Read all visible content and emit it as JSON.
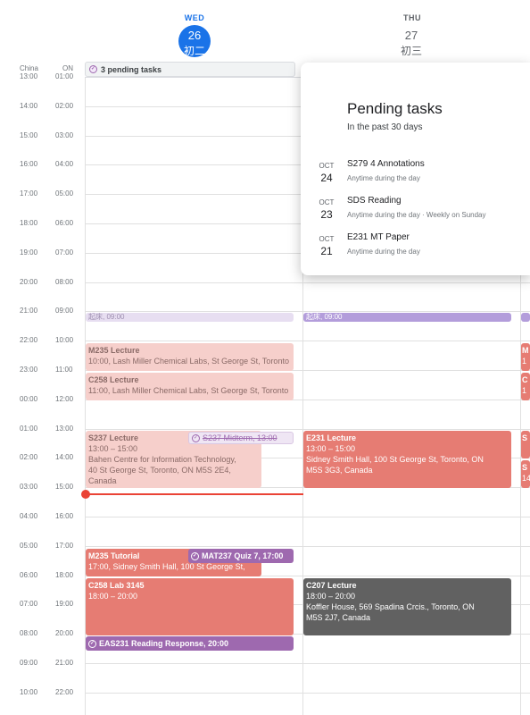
{
  "days": [
    {
      "dow": "WED",
      "num": "26",
      "lunar": "初二"
    },
    {
      "dow": "THU",
      "num": "27",
      "lunar": "初三"
    }
  ],
  "timezones": {
    "primary": "China",
    "secondary": "ON"
  },
  "times": [
    [
      "13:00",
      "01:00"
    ],
    [
      "14:00",
      "02:00"
    ],
    [
      "15:00",
      "03:00"
    ],
    [
      "16:00",
      "04:00"
    ],
    [
      "17:00",
      "05:00"
    ],
    [
      "18:00",
      "06:00"
    ],
    [
      "19:00",
      "07:00"
    ],
    [
      "20:00",
      "08:00"
    ],
    [
      "21:00",
      "09:00"
    ],
    [
      "22:00",
      "10:00"
    ],
    [
      "23:00",
      "11:00"
    ],
    [
      "00:00",
      "12:00"
    ],
    [
      "01:00",
      "13:00"
    ],
    [
      "02:00",
      "14:00"
    ],
    [
      "03:00",
      "15:00"
    ],
    [
      "04:00",
      "16:00"
    ],
    [
      "05:00",
      "17:00"
    ],
    [
      "06:00",
      "18:00"
    ],
    [
      "07:00",
      "19:00"
    ],
    [
      "08:00",
      "20:00"
    ],
    [
      "09:00",
      "21:00"
    ],
    [
      "10:00",
      "22:00"
    ]
  ],
  "pending_bar": {
    "label": "3 pending tasks"
  },
  "popover": {
    "title": "Pending tasks",
    "subtitle": "In the past 30 days",
    "tasks": [
      {
        "month": "OCT",
        "day": "24",
        "name": "S279 4 Annotations",
        "when": "Anytime during the day"
      },
      {
        "month": "OCT",
        "day": "23",
        "name": "SDS Reading",
        "when": "Anytime during the day  ·  Weekly on Sunday"
      },
      {
        "month": "OCT",
        "day": "21",
        "name": "E231 MT Paper",
        "when": "Anytime during the day"
      }
    ]
  },
  "events": {
    "wake_wed": "起床, 09:00",
    "wake_thu": "起床, 09:00",
    "m235_lecture": {
      "title": "M235 Lecture",
      "sub": "10:00, Lash Miller Chemical Labs, St George St, Toronto"
    },
    "c258_lecture": {
      "title": "C258 Lecture",
      "sub": "11:00, Lash Miller Chemical Labs, St George St, Toronto"
    },
    "s237_lecture": {
      "title": "S237 Lecture",
      "time": "13:00 – 15:00",
      "loc1": "Bahen Centre for Information Technology,",
      "loc2": "40 St George St, Toronto, ON M5S 2E4,",
      "loc3": "Canada"
    },
    "s237_midterm": "S237 Midterm, 13:00",
    "e231_lecture": {
      "title": "E231 Lecture",
      "time": "13:00 – 15:00",
      "loc1": "Sidney Smith Hall, 100 St George St, Toronto, ON",
      "loc2": "M5S 3G3, Canada"
    },
    "m235_tutorial": {
      "title": "M235 Tutorial",
      "sub": "17:00, Sidney Smith Hall, 100 St George St,"
    },
    "mat237_quiz": "MAT237 Quiz 7, 17:00",
    "c258_lab": {
      "title": "C258 Lab 3145",
      "time": "18:00 – 20:00"
    },
    "c207_lecture": {
      "title": "C207 Lecture",
      "time": "18:00 – 20:00",
      "loc1": "Koffler House, 569 Spadina Crcis., Toronto, ON",
      "loc2": "M5S 2J7, Canada"
    },
    "eas231": "EAS231 Reading Response, 20:00",
    "fri_m": "M",
    "fri_1": "1",
    "fri_c": "C",
    "fri_11": "1",
    "fri_s": "S",
    "fri_s2": "S",
    "fri_14": "14"
  },
  "colors": {
    "accent": "#1a73e8",
    "now_line": "#ea4335",
    "event_red": "#e67c73",
    "event_purple": "#9e69af",
    "event_dark": "#616161"
  }
}
